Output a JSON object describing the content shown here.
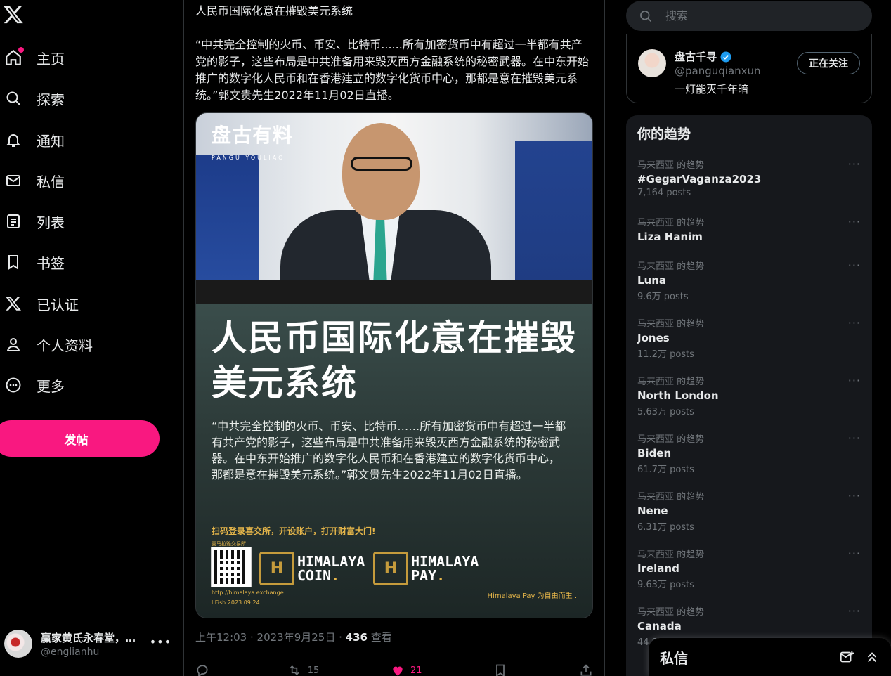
{
  "nav": {
    "items": [
      {
        "label": "主页",
        "icon": "home-icon"
      },
      {
        "label": "探索",
        "icon": "search-icon"
      },
      {
        "label": "通知",
        "icon": "bell-icon"
      },
      {
        "label": "私信",
        "icon": "mail-icon"
      },
      {
        "label": "列表",
        "icon": "list-icon"
      },
      {
        "label": "书签",
        "icon": "bookmark-icon"
      },
      {
        "label": "已认证",
        "icon": "x-logo-icon"
      },
      {
        "label": "个人资料",
        "icon": "person-icon"
      },
      {
        "label": "更多",
        "icon": "more-circle-icon"
      }
    ],
    "post_label": "发帖",
    "account": {
      "name": "赢家黄氏永春堂，联...",
      "handle": "@englianhu"
    }
  },
  "tweet": {
    "headline": "人民币国际化意在摧毁美元系统",
    "body": "“中共完全控制的火币、币安、比特币......所有加密货币中有超过一半都有共产党的影子，这些布局是中共准备用来毁灭西方金融系统的秘密武器。在中东开始推广的数字化人民币和在香港建立的数字化货币中心，那都是意在摧毁美元系统。”郭文贵先生2022年11月02日直播。",
    "media": {
      "brand": "盘古有料",
      "brand_sub": "PANGU YOULIAO",
      "poster_title": "人民币国际化意在摧毁美元系统",
      "poster_quote": "“中共完全控制的火币、币安、比特币……所有加密货币中有超过一半都有共产党的影子，这些布局是中共准备用来毁灭西方金融系统的秘密武器。在中东开始推广的数字化人民币和在香港建立的数字化货币中心，那都是意在摧毁美元系统。”郭文贵先生2022年11月02日直播。",
      "cta": "扫码登录喜交所，开设账户，打开财富大门!",
      "cta_small": "喜马拉雅交易所",
      "coin_name": "HIMALAYA",
      "coin_sub": "COIN",
      "pay_name": "HIMALAYA",
      "pay_sub": "PAY",
      "url": "http://himalaya.exchange",
      "fish": "l Fish  2023.09.24",
      "pay_slogan": "Himalaya Pay 为自由而生 ."
    },
    "timestamp": "上午12:03 · 2023年9月25日 · ",
    "views_count": "436",
    "views_label": " 查看",
    "actions": {
      "reply": "",
      "retweet": "15",
      "like": "21",
      "bookmark": "",
      "share": ""
    }
  },
  "sidebar": {
    "search_placeholder": "搜索",
    "follow": {
      "name": "盘古千寻",
      "handle": "@panguqianxun",
      "bio": "一灯能灭千年暗",
      "button": "正在关注"
    },
    "trends_title": "你的趋势",
    "trends": [
      {
        "context": "马来西亚 的趋势",
        "name": "#GegarVaganza2023",
        "count": "7,164 posts"
      },
      {
        "context": "马来西亚 的趋势",
        "name": "Liza Hanim",
        "count": ""
      },
      {
        "context": "马来西亚 的趋势",
        "name": "Luna",
        "count": "9.6万 posts"
      },
      {
        "context": "马来西亚 的趋势",
        "name": "Jones",
        "count": "11.2万 posts"
      },
      {
        "context": "马来西亚 的趋势",
        "name": "North London",
        "count": "5.63万 posts"
      },
      {
        "context": "马来西亚 的趋势",
        "name": "Biden",
        "count": "61.7万 posts"
      },
      {
        "context": "马来西亚 的趋势",
        "name": "Nene",
        "count": "6.31万 posts"
      },
      {
        "context": "马来西亚 的趋势",
        "name": "Ireland",
        "count": "9.63万 posts"
      },
      {
        "context": "马来西亚 的趋势",
        "name": "Canada",
        "count": "44.8万 posts"
      }
    ],
    "trend_more": "···"
  },
  "dm_drawer": {
    "title": "私信"
  },
  "colors": {
    "accent": "#f91880",
    "bg": "#000000",
    "text": "#e7e9ea",
    "muted": "#71767b",
    "border": "#2f3336"
  }
}
